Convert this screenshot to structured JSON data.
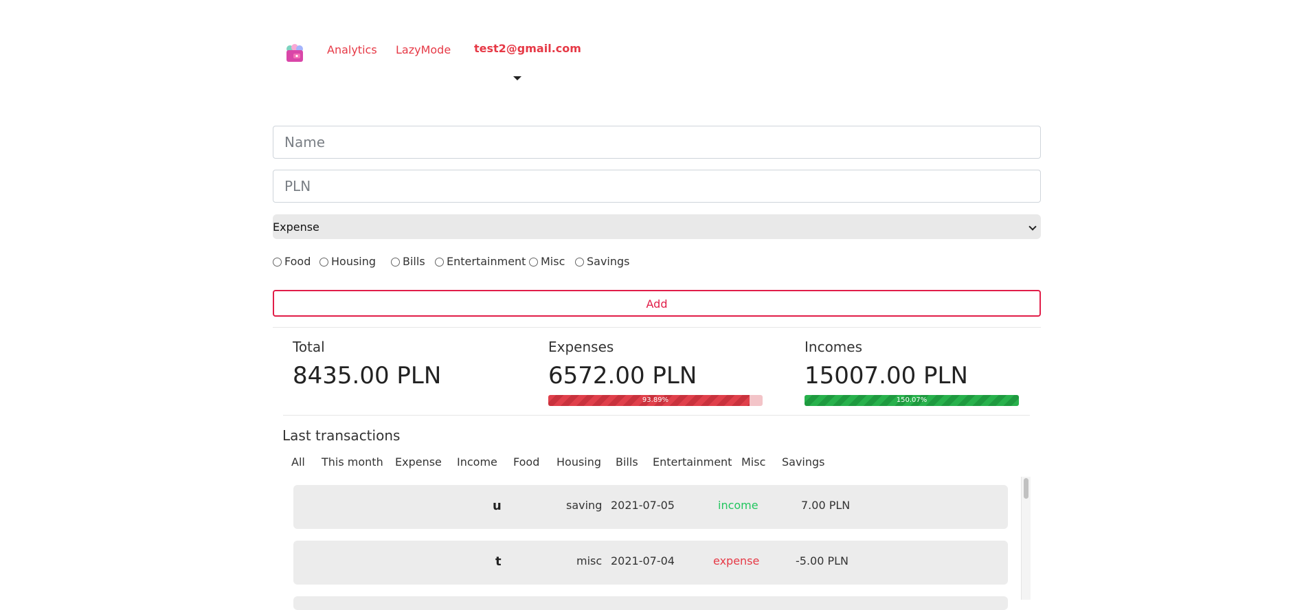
{
  "header": {
    "nav": {
      "analytics": "Analytics",
      "lazymode": "LazyMode"
    },
    "user_email": "test2@gmail.com"
  },
  "form": {
    "name_placeholder": "Name",
    "amount_placeholder": "PLN",
    "type_selected": "Expense",
    "categories": [
      "Food",
      "Housing",
      "Bills",
      "Entertainment",
      "Misc",
      "Savings"
    ],
    "add_label": "Add"
  },
  "stats": {
    "total": {
      "label": "Total",
      "value": "8435.00 PLN"
    },
    "expenses": {
      "label": "Expenses",
      "value": "6572.00 PLN",
      "progress_text": "93.89%",
      "progress": 93.89
    },
    "incomes": {
      "label": "Incomes",
      "value": "15007.00 PLN",
      "progress_text": "150.07%",
      "progress": 150.07
    }
  },
  "transactions": {
    "title": "Last transactions",
    "filters": [
      "All",
      "This month",
      "Expense",
      "Income",
      "Food",
      "Housing",
      "Bills",
      "Entertainment",
      "Misc",
      "Savings"
    ],
    "rows": [
      {
        "name": "u",
        "category": "saving",
        "date": "2021-07-05",
        "type": "income",
        "amount": "7.00 PLN"
      },
      {
        "name": "t",
        "category": "misc",
        "date": "2021-07-04",
        "type": "expense",
        "amount": "-5.00 PLN"
      }
    ]
  },
  "colors": {
    "accent": "#e63946",
    "add_border": "#e11d48",
    "income": "#22c55e",
    "expense": "#e63946"
  },
  "icons": {
    "logo": "wallet-logo-icon",
    "dropdown": "caret-down-icon"
  }
}
